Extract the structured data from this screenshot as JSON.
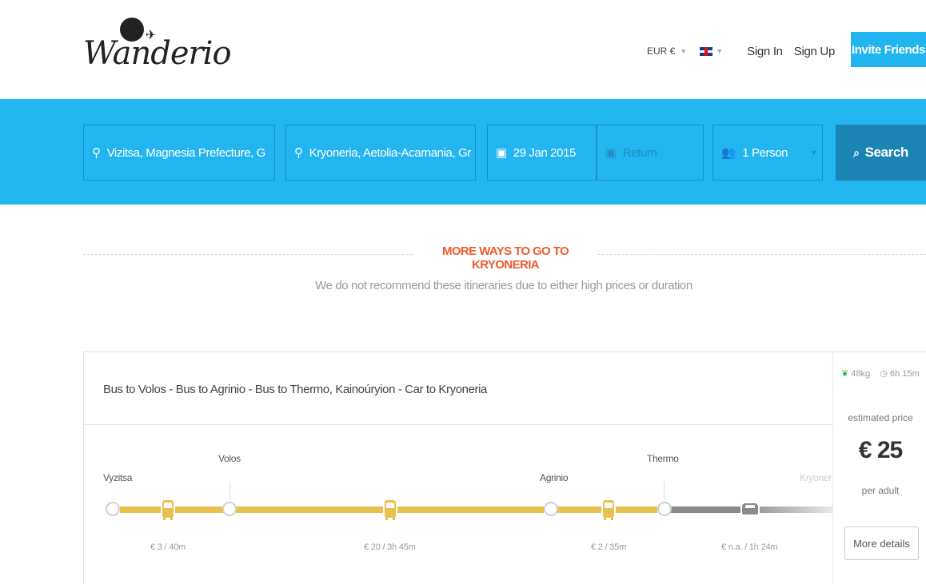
{
  "header": {
    "logo_text": "Wanderio",
    "currency": "EUR €",
    "caret": "▼",
    "sign_in": "Sign In",
    "sign_up": "Sign Up",
    "invite": "Invite Friends"
  },
  "search": {
    "from": "Vizitsa, Magnesia Prefecture, G",
    "to": "Kryoneria, Aetolia-Acarnania, Gr",
    "depart": "29 Jan 2015",
    "return_placeholder": "Return",
    "passengers": "1 Person",
    "search_label": "Search"
  },
  "section": {
    "title": "MORE WAYS TO GO TO KRYONERIA",
    "subtitle": "We do not recommend these itineraries due to either high prices or duration"
  },
  "itinerary": {
    "title": "Bus to Volos - Bus to Agrinio - Bus to Thermo, Kainoúryion - Car to Kryoneria",
    "co2": "48kg",
    "duration": "6h 15m",
    "estimated_label": "estimated price",
    "price": "€ 25",
    "per_adult": "per adult",
    "more_details": "More details",
    "stops": [
      "Vyzitsa",
      "Volos",
      "Agrinio",
      "Thermo",
      "Kryoneria"
    ],
    "legs": [
      {
        "mode": "bus",
        "cost": "€ 3 / 40m"
      },
      {
        "mode": "bus",
        "cost": "€ 20 / 3h 45m"
      },
      {
        "mode": "bus",
        "cost": "€ 2 / 35m"
      },
      {
        "mode": "car",
        "cost": "€ n.a. / 1h 24m"
      }
    ]
  },
  "colors": {
    "brand_blue": "#23b5ef",
    "search_button": "#1b84b3",
    "accent_orange": "#ee5a2c",
    "bus_yellow": "#e8c04d",
    "car_gray": "#8a8a8a"
  }
}
